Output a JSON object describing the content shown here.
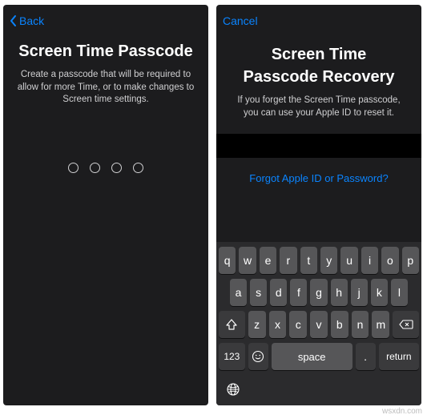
{
  "left": {
    "back_label": "Back",
    "title": "Screen Time Passcode",
    "subtitle": "Create a passcode that will be required to allow for more Time, or to make changes to Screen time settings."
  },
  "right": {
    "cancel_label": "Cancel",
    "title_line1": "Screen Time",
    "title_line2": "Passcode Recovery",
    "subtitle": "If you forget the Screen Time passcode, you can use your Apple ID to reset it.",
    "forgot_label": "Forgot Apple ID or Password?"
  },
  "keyboard": {
    "row1": [
      "q",
      "w",
      "e",
      "r",
      "t",
      "y",
      "u",
      "i",
      "o",
      "p"
    ],
    "row2": [
      "a",
      "s",
      "d",
      "f",
      "g",
      "h",
      "j",
      "k",
      "l"
    ],
    "row3": [
      "z",
      "x",
      "c",
      "v",
      "b",
      "n",
      "m"
    ],
    "num_label": "123",
    "space_label": "space",
    "return_label": "return",
    "period": "."
  },
  "watermark": "wsxdn.com"
}
